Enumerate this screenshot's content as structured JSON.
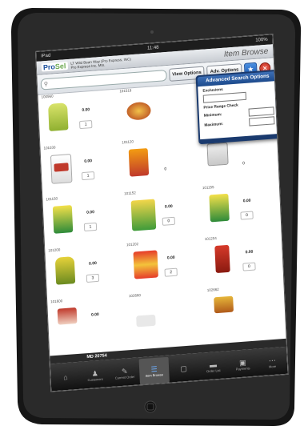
{
  "status": {
    "carrier": "iPad",
    "time": "11:48",
    "battery": "100%"
  },
  "header": {
    "logo_main": "Pro",
    "logo_accent": "Sel",
    "company_line1": "LT Wild Bean Way (Pro Express, INC)",
    "company_line2": "Pro Express Inc, Mtn.",
    "title": "Item Browse"
  },
  "toolbar": {
    "search_placeholder": "",
    "view_options": "View Options",
    "adv_options": "Adv. Options"
  },
  "popover": {
    "title": "Advanced Search Options",
    "exclusions_label": "Exclusions",
    "price_range_label": "Price Range Check",
    "minimum_label": "Minimum:",
    "maximum_label": "Maximum:"
  },
  "cells": [
    {
      "code": "100960",
      "price": "0.00",
      "qty": "1"
    },
    {
      "code": "101519",
      "price": "",
      "qty": ""
    },
    {
      "code": "101947",
      "price": "",
      "qty": ""
    },
    {
      "code": "101030",
      "price": "0.00",
      "qty": "1"
    },
    {
      "code": "101120",
      "price": "",
      "qty": "0"
    },
    {
      "code": "",
      "price": "",
      "qty": "0"
    },
    {
      "code": "101150",
      "price": "0.00",
      "qty": "1"
    },
    {
      "code": "101152",
      "price": "0.00",
      "qty": "0"
    },
    {
      "code": "101155",
      "price": "0.00",
      "qty": "0"
    },
    {
      "code": "101200",
      "price": "0.00",
      "qty": "3"
    },
    {
      "code": "101202",
      "price": "0.00",
      "qty": "2"
    },
    {
      "code": "101204",
      "price": "0.00",
      "qty": "0"
    },
    {
      "code": "101600",
      "price": "0.00",
      "qty": "3"
    },
    {
      "code": "102660",
      "price": "0.00",
      "qty": "1"
    },
    {
      "code": "102662",
      "price": "0.00",
      "qty": "2"
    }
  ],
  "bottom_row": {
    "price": "0.00"
  },
  "md_bar": "MD 20754",
  "tabs": [
    {
      "label": "",
      "icon": "home-icon"
    },
    {
      "label": "Customers",
      "icon": "customers-icon"
    },
    {
      "label": "Current Order",
      "icon": "order-icon"
    },
    {
      "label": "Item Browse",
      "icon": "browse-icon"
    },
    {
      "label": "",
      "icon": "blank-icon"
    },
    {
      "label": "Order List",
      "icon": "order-list-icon"
    },
    {
      "label": "Payments",
      "icon": "payments-icon"
    },
    {
      "label": "More",
      "icon": "more-icon"
    }
  ],
  "colors": {
    "accent": "#1c4a8c",
    "logo": "#1a4f9c",
    "logo_accent": "#6aa84f",
    "close": "#c0281a",
    "star": "#1f5eb8"
  }
}
